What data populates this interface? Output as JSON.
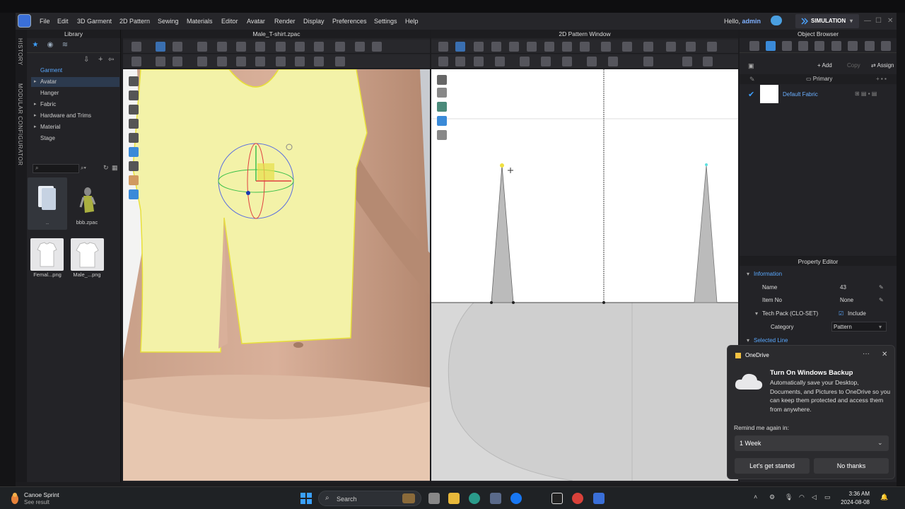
{
  "menu": {
    "items": [
      "File",
      "Edit",
      "3D Garment",
      "2D Pattern",
      "Sewing",
      "Materials",
      "Editor",
      "Avatar",
      "Render",
      "Display",
      "Preferences",
      "Settings",
      "Help"
    ],
    "hello_prefix": "Hello,",
    "user": "admin",
    "simulation_label": "SIMULATION"
  },
  "side_tabs": {
    "history": "HISTORY",
    "modular": "MODULAR CONFIGURATOR"
  },
  "library": {
    "title": "Library",
    "tree": [
      {
        "label": "Garment",
        "type": "header"
      },
      {
        "label": "Avatar",
        "type": "arrow",
        "selected": true
      },
      {
        "label": "Hanger",
        "type": "plain"
      },
      {
        "label": "Fabric",
        "type": "arrow"
      },
      {
        "label": "Hardware and Trims",
        "type": "arrow"
      },
      {
        "label": "Material",
        "type": "arrow"
      },
      {
        "label": "Stage",
        "type": "plain"
      }
    ],
    "files": [
      {
        "label": ".."
      },
      {
        "label": "bbb.zpac"
      },
      {
        "label": "Femal...png"
      },
      {
        "label": "Male_...png"
      }
    ]
  },
  "window3d": {
    "title": "Male_T-shirt.zpac"
  },
  "window2d": {
    "title": "2D Pattern Window"
  },
  "object_browser": {
    "title": "Object Browser",
    "add_label": "Add",
    "copy_label": "Copy",
    "assign_label": "Assign",
    "primary_label": "Primary",
    "fabric_name": "Default Fabric"
  },
  "property_editor": {
    "title": "Property Editor",
    "information_label": "Information",
    "rows": [
      {
        "label": "Name",
        "value": "43"
      },
      {
        "label": "Item No",
        "value": "None"
      },
      {
        "label": "Tech Pack (CLO-SET)",
        "value": "Include"
      },
      {
        "label": "Category",
        "value": "Pattern"
      }
    ],
    "selected_line_label": "Selected Line"
  },
  "toast": {
    "app": "OneDrive",
    "title": "Turn On Windows Backup",
    "body": "Automatically save your Desktop, Documents, and Pictures to OneDrive so you can keep them protected and access them from anywhere.",
    "remind_label": "Remind me again in:",
    "remind_value": "1 Week",
    "primary_button": "Let's get started",
    "secondary_button": "No thanks"
  },
  "taskbar": {
    "weather_title": "Canoe Sprint",
    "weather_sub": "See result",
    "search_placeholder": "Search",
    "time": "3:36 AM",
    "date": "2024-08-08"
  },
  "colors": {
    "accent": "#3ea0ff",
    "garment": "#f3f2a8",
    "garment_outline": "#e8e03a"
  }
}
